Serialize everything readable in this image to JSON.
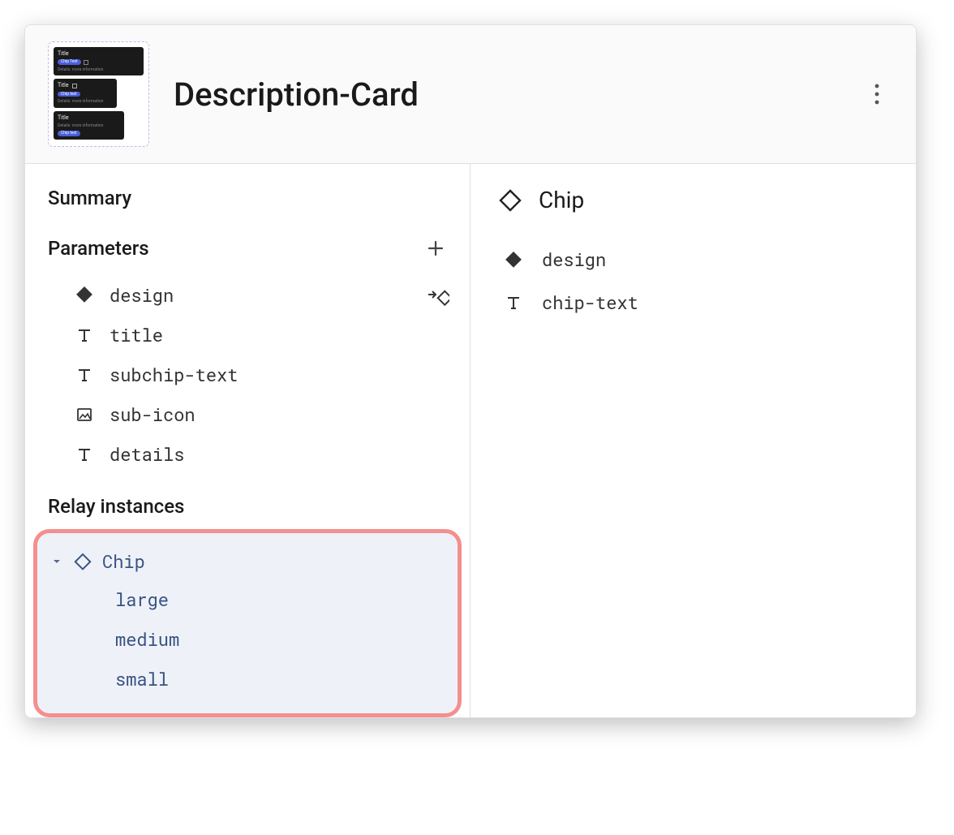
{
  "header": {
    "title": "Description-Card"
  },
  "left": {
    "summary_label": "Summary",
    "parameters_label": "Parameters",
    "parameters": [
      {
        "name": "design",
        "icon": "diamond-filled",
        "trail": "arrow-into-diamond"
      },
      {
        "name": "title",
        "icon": "text"
      },
      {
        "name": "subchip-text",
        "icon": "text"
      },
      {
        "name": "sub-icon",
        "icon": "image"
      },
      {
        "name": "details",
        "icon": "text"
      }
    ],
    "relay_label": "Relay instances",
    "instances": [
      {
        "name": "Chip",
        "expanded": true,
        "variants": [
          "large",
          "medium",
          "small"
        ]
      }
    ]
  },
  "right": {
    "title": "Chip",
    "properties": [
      {
        "name": "design",
        "icon": "diamond-filled"
      },
      {
        "name": "chip-text",
        "icon": "text"
      }
    ]
  }
}
